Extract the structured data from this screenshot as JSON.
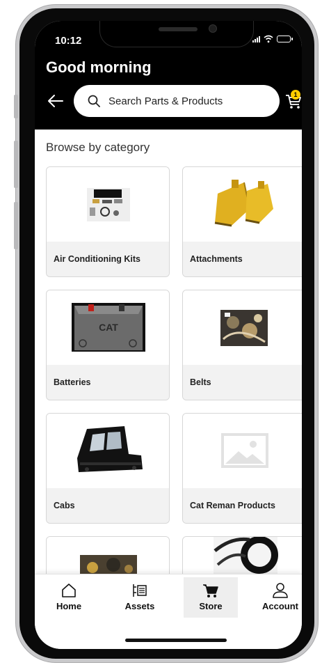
{
  "status_bar": {
    "time": "10:12"
  },
  "header": {
    "greeting": "Good morning",
    "search_placeholder": "Search Parts & Products",
    "cart_count": "1"
  },
  "section_title": "Browse by category",
  "categories": [
    {
      "label": "Air Conditioning Kits"
    },
    {
      "label": "Attachments"
    },
    {
      "label": "Batteries"
    },
    {
      "label": "Belts"
    },
    {
      "label": "Cabs"
    },
    {
      "label": "Cat Reman Products"
    }
  ],
  "bottom_nav": {
    "home": "Home",
    "assets": "Assets",
    "store": "Store",
    "account": "Account",
    "active": "Store"
  },
  "colors": {
    "header_bg": "#000000",
    "accent_yellow": "#ffcc00",
    "card_label_bg": "#f2f2f2"
  }
}
